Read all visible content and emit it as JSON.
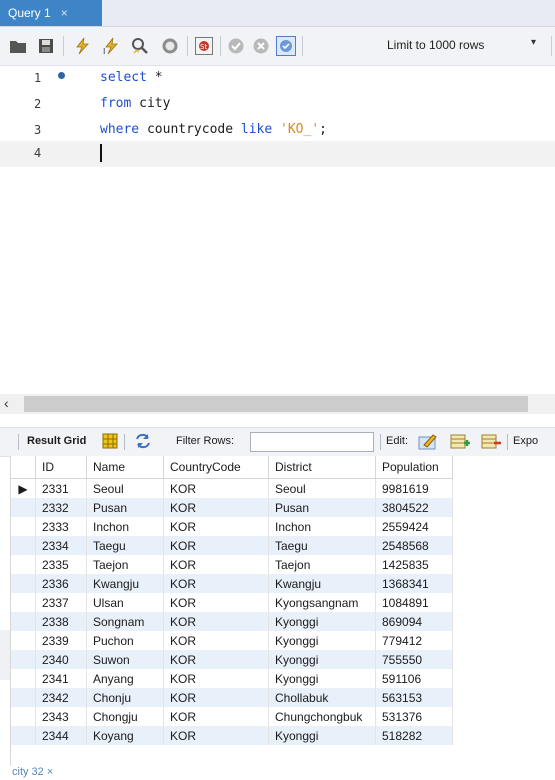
{
  "tab": {
    "title": "Query 1",
    "close": "×"
  },
  "toolbar": {
    "icons": [
      "open-file-icon",
      "save-icon",
      "execute-icon",
      "execute-current-icon",
      "explain-icon",
      "stop-icon",
      "toggle-error-icon",
      "commit-icon",
      "rollback-icon",
      "autocommit-icon"
    ],
    "limit_label": "Limit to 1000 rows",
    "limit_dropdown": "▾"
  },
  "editor": {
    "lines": [
      {
        "num": "1",
        "tokens": [
          {
            "t": "select",
            "c": "kw"
          },
          {
            "t": " *",
            "c": ""
          }
        ]
      },
      {
        "num": "2",
        "tokens": [
          {
            "t": "from",
            "c": "kw"
          },
          {
            "t": " city",
            "c": ""
          }
        ]
      },
      {
        "num": "3",
        "tokens": [
          {
            "t": "where",
            "c": "kw"
          },
          {
            "t": " countrycode ",
            "c": ""
          },
          {
            "t": "like",
            "c": "kw"
          },
          {
            "t": " ",
            "c": ""
          },
          {
            "t": "'KO_'",
            "c": "str"
          },
          {
            "t": ";",
            "c": ""
          }
        ]
      },
      {
        "num": "4",
        "tokens": []
      }
    ]
  },
  "result_toolbar": {
    "result_grid": "Result Grid",
    "filter_rows": "Filter Rows:",
    "edit": "Edit:",
    "export": "Expo"
  },
  "grid": {
    "columns": [
      "ID",
      "Name",
      "CountryCode",
      "District",
      "Population"
    ],
    "rows": [
      [
        "2331",
        "Seoul",
        "KOR",
        "Seoul",
        "9981619"
      ],
      [
        "2332",
        "Pusan",
        "KOR",
        "Pusan",
        "3804522"
      ],
      [
        "2333",
        "Inchon",
        "KOR",
        "Inchon",
        "2559424"
      ],
      [
        "2334",
        "Taegu",
        "KOR",
        "Taegu",
        "2548568"
      ],
      [
        "2335",
        "Taejon",
        "KOR",
        "Taejon",
        "1425835"
      ],
      [
        "2336",
        "Kwangju",
        "KOR",
        "Kwangju",
        "1368341"
      ],
      [
        "2337",
        "Ulsan",
        "KOR",
        "Kyongsangnam",
        "1084891"
      ],
      [
        "2338",
        "Songnam",
        "KOR",
        "Kyonggi",
        "869094"
      ],
      [
        "2339",
        "Puchon",
        "KOR",
        "Kyonggi",
        "779412"
      ],
      [
        "2340",
        "Suwon",
        "KOR",
        "Kyonggi",
        "755550"
      ],
      [
        "2341",
        "Anyang",
        "KOR",
        "Kyonggi",
        "591106"
      ],
      [
        "2342",
        "Chonju",
        "KOR",
        "Chollabuk",
        "563153"
      ],
      [
        "2343",
        "Chongju",
        "KOR",
        "Chungchongbuk",
        "531376"
      ],
      [
        "2344",
        "Koyang",
        "KOR",
        "Kyonggi",
        "518282"
      ]
    ],
    "current_row_marker": "▶"
  },
  "bottom_tab": {
    "label": "city 32",
    "close": "×"
  },
  "colors": {
    "tab_active": "#3d85c6",
    "keyword": "#1f4fd1",
    "string": "#d98a1f",
    "row_alt": "#e8f0fa"
  }
}
